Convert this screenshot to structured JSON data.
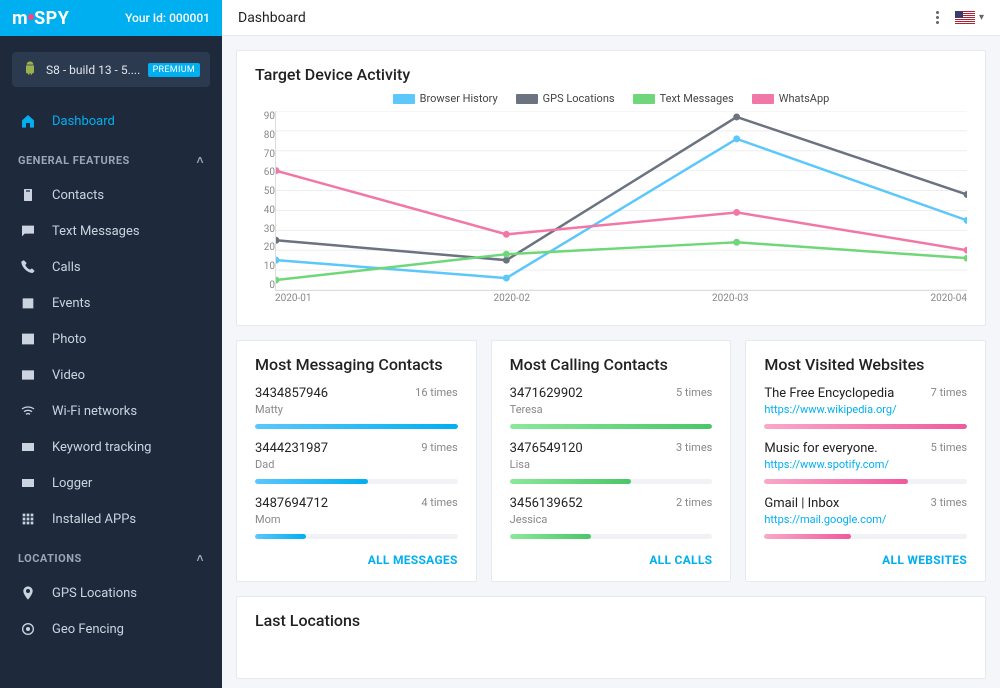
{
  "brand": "mSPY",
  "user_id": "Your Id: 000001",
  "device": {
    "name": "S8 - build 13 - 5....",
    "badge": "PREMIUM"
  },
  "nav": {
    "dashboard": "Dashboard",
    "section_general": "GENERAL FEATURES",
    "items_general": [
      {
        "label": "Contacts"
      },
      {
        "label": "Text Messages"
      },
      {
        "label": "Calls"
      },
      {
        "label": "Events"
      },
      {
        "label": "Photo"
      },
      {
        "label": "Video"
      },
      {
        "label": "Wi-Fi networks"
      },
      {
        "label": "Keyword tracking"
      },
      {
        "label": "Logger"
      },
      {
        "label": "Installed APPs"
      }
    ],
    "section_locations": "LOCATIONS",
    "items_locations": [
      {
        "label": "GPS Locations"
      },
      {
        "label": "Geo Fencing"
      }
    ]
  },
  "page_title": "Dashboard",
  "chart_card_title": "Target Device Activity",
  "chart_data": {
    "type": "line",
    "x": [
      "2020-01",
      "2020-02",
      "2020-03",
      "2020-04"
    ],
    "ylim": [
      0,
      90
    ],
    "yticks": [
      0,
      10,
      20,
      30,
      40,
      50,
      60,
      70,
      80,
      90
    ],
    "series": [
      {
        "name": "Browser History",
        "color": "#5bc7fb",
        "values": [
          15,
          6,
          76,
          35
        ]
      },
      {
        "name": "GPS Locations",
        "color": "#6b7280",
        "values": [
          25,
          15,
          87,
          48
        ]
      },
      {
        "name": "Text Messages",
        "color": "#6fd77a",
        "values": [
          5,
          18,
          24,
          16
        ]
      },
      {
        "name": "WhatsApp",
        "color": "#f178a6",
        "values": [
          60,
          28,
          39,
          20
        ]
      }
    ]
  },
  "messaging": {
    "title": "Most Messaging Contacts",
    "rows": [
      {
        "num": "3434857946",
        "name": "Matty",
        "count": "16 times",
        "pct": 100
      },
      {
        "num": "3444231987",
        "name": "Dad",
        "count": "9 times",
        "pct": 56
      },
      {
        "num": "3487694712",
        "name": "Mom",
        "count": "4 times",
        "pct": 25
      }
    ],
    "footer": "ALL MESSAGES"
  },
  "calling": {
    "title": "Most Calling Contacts",
    "rows": [
      {
        "num": "3471629902",
        "name": "Teresa",
        "count": "5 times",
        "pct": 100
      },
      {
        "num": "3476549120",
        "name": "Lisa",
        "count": "3 times",
        "pct": 60
      },
      {
        "num": "3456139652",
        "name": "Jessica",
        "count": "2 times",
        "pct": 40
      }
    ],
    "footer": "ALL CALLS"
  },
  "websites": {
    "title": "Most Visited Websites",
    "rows": [
      {
        "name": "The Free Encyclopedia",
        "url": "https://www.wikipedia.org/",
        "count": "7 times",
        "pct": 100
      },
      {
        "name": "Music for everyone.",
        "url": "https://www.spotify.com/",
        "count": "5 times",
        "pct": 71
      },
      {
        "name": "Gmail | Inbox",
        "url": "https://mail.google.com/",
        "count": "3 times",
        "pct": 43
      }
    ],
    "footer": "ALL WEBSITES"
  },
  "last_locations_title": "Last Locations"
}
